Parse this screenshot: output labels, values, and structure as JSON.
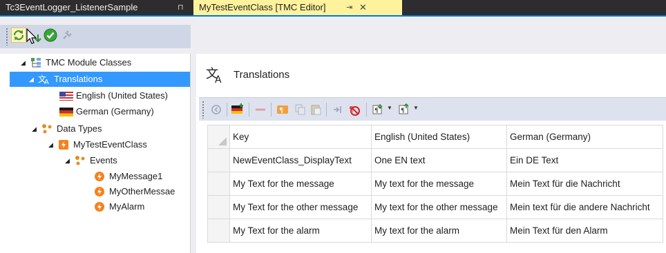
{
  "tabs": {
    "listener": {
      "label": "Tc3EventLogger_ListenerSample",
      "pin": "⊓"
    },
    "editor": {
      "label": "MyTestEventClass [TMC Editor]",
      "pin": "⇥",
      "close": "✕"
    }
  },
  "tree": {
    "root": "TMC Module Classes",
    "translations": "Translations",
    "english": "English (United States)",
    "german": "German (Germany)",
    "data_types": "Data Types",
    "event_class": "MyTestEventClass",
    "events": "Events",
    "event_items": [
      "MyMessage1",
      "MyOtherMessae",
      "MyAlarm"
    ]
  },
  "panel": {
    "title": "Translations"
  },
  "grid": {
    "headers": [
      "Key",
      "English (United States)",
      "German (Germany)"
    ],
    "rows": [
      [
        "NewEventClass_DisplayText",
        "One EN text",
        "Ein DE Text"
      ],
      [
        "My Text for the message",
        "My text for the message",
        "Mein Text für die Nachricht"
      ],
      [
        "My Text for the other message",
        "My text for the other message",
        "Mein text für die andere Nachricht"
      ],
      [
        "My Text for the alarm",
        "My text for the alarm",
        "Mein Text für den Alarm"
      ]
    ]
  },
  "colors": {
    "accent": "#007acc",
    "selection": "#3399ff",
    "active_tab": "#fff29d",
    "event_icon": "#f5821f"
  }
}
